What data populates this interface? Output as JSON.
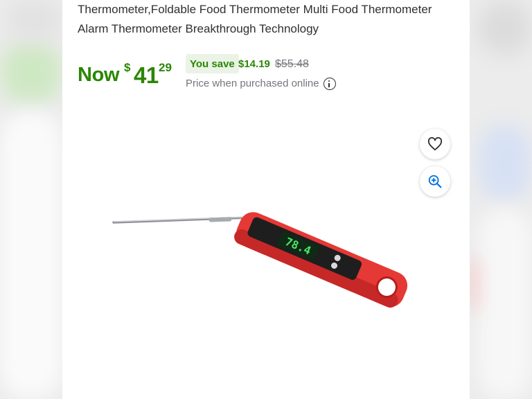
{
  "product": {
    "title_line1": "Thermometer,Foldable Food Thermometer Multi Food Thermometer",
    "title_line2": "Alarm Thermometer Breakthrough Technology"
  },
  "price": {
    "now_label": "Now",
    "currency": "$",
    "dollars": "41",
    "cents": "29",
    "you_save_label": "You save",
    "save_amount": "$14.19",
    "was_price": "$55.48",
    "price_note": "Price when purchased online"
  },
  "icons": {
    "info": "info-icon",
    "favorite": "heart-icon",
    "zoom": "zoom-in-icon"
  },
  "colors": {
    "accent_green": "#2a8703",
    "badge_bg": "#eaf3e6",
    "thermometer_red": "#e53935"
  },
  "thermometer_display": "78.4"
}
